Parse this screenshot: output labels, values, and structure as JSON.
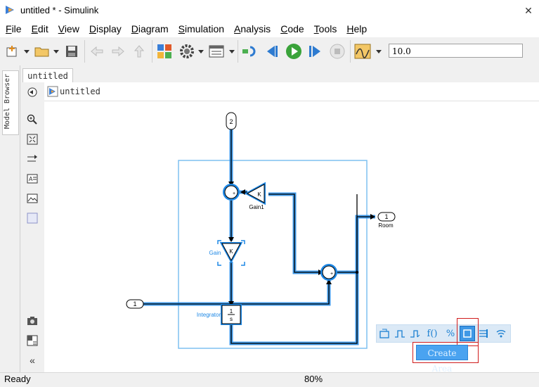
{
  "window": {
    "title": "untitled * - Simulink"
  },
  "menu": [
    {
      "label": "File",
      "key": "F",
      "rest": "ile"
    },
    {
      "label": "Edit",
      "key": "E",
      "rest": "dit"
    },
    {
      "label": "View",
      "key": "V",
      "rest": "iew"
    },
    {
      "label": "Display",
      "key": "D",
      "rest": "isplay"
    },
    {
      "label": "Diagram",
      "key": "D",
      "rest": "iagram"
    },
    {
      "label": "Simulation",
      "key": "S",
      "rest": "imulation"
    },
    {
      "label": "Analysis",
      "key": "A",
      "rest": "nalysis"
    },
    {
      "label": "Code",
      "key": "C",
      "rest": "ode"
    },
    {
      "label": "Tools",
      "key": "T",
      "rest": "ools"
    },
    {
      "label": "Help",
      "key": "H",
      "rest": "elp"
    }
  ],
  "toolbar": {
    "stop_time": "10.0"
  },
  "sidebar": {
    "model_browser_label": "Model Browser"
  },
  "tabs": {
    "model_tab": "untitled"
  },
  "breadcrumb": {
    "model_name": "untitled"
  },
  "diagram": {
    "inport_top": "2",
    "inport_left": "1",
    "outport_right": "1",
    "outport_label": "Room",
    "gain1_symbol": "K",
    "gain1_label": "Gain1",
    "gain_symbol": "K",
    "gain_label": "Gain",
    "integrator_num": "1",
    "integrator_den": "s",
    "integrator_label": "Integrator",
    "sum_top_signs": "+",
    "sum_bottom_signs": "+"
  },
  "quick_toolbar": {
    "pct_label": "%",
    "fn_label": "f()"
  },
  "create_area": {
    "label": "Create Area"
  },
  "status": {
    "text": "Ready",
    "zoom": "80%"
  },
  "colors": {
    "selection": "#1e88e5",
    "area_border": "#7ec0f0",
    "highlight_box": "#d01c1c"
  }
}
